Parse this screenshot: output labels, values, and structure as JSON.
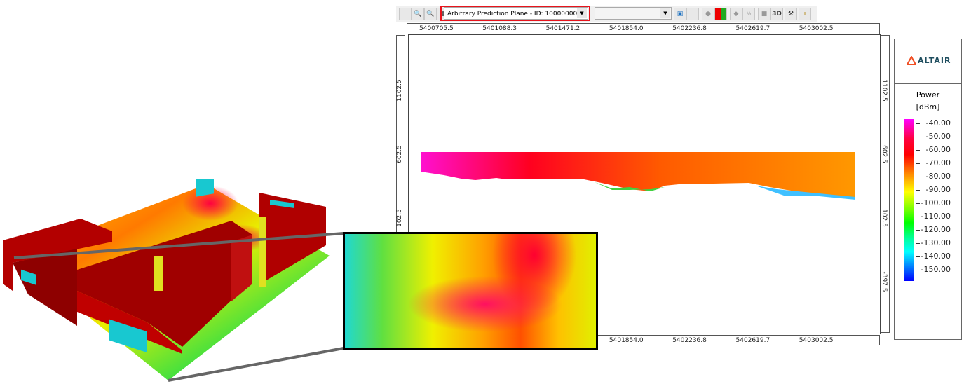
{
  "toolbar": {
    "icons": [
      "stop-icon",
      "zoom-out-icon",
      "zoom-in-icon",
      "select-plane-icon"
    ],
    "plane_select": {
      "value": "Arbitrary Prediction Plane - ID: 10000000"
    },
    "second_select": {
      "value": ""
    },
    "right_icons": [
      "screenshot-icon",
      "square-icon",
      "circle-icon",
      "color-scale-icon",
      "tag-icon",
      "fraction-icon",
      "layers-icon",
      "3d-icon",
      "tools-icon",
      "info-icon"
    ],
    "label_3d": "3D",
    "highlight_color": "#e8141c"
  },
  "rulers": {
    "x_ticks": [
      "5400705.5",
      "5401088.3",
      "5401471.2",
      "5401854.0",
      "5402236.8",
      "5402619.7",
      "5403002.5"
    ],
    "y_ticks": [
      "1102.5",
      "602.5",
      "102.5",
      "-397.5"
    ]
  },
  "legend": {
    "brand": "ALTAIR",
    "title": "Power",
    "unit": "[dBm]",
    "values": [
      "-40.00",
      "-50.00",
      "-60.00",
      "-70.00",
      "-80.00",
      "-90.00",
      "-100.00",
      "-110.00",
      "-120.00",
      "-130.00",
      "-140.00",
      "-150.00"
    ],
    "brand_color": "#f04e23"
  }
}
